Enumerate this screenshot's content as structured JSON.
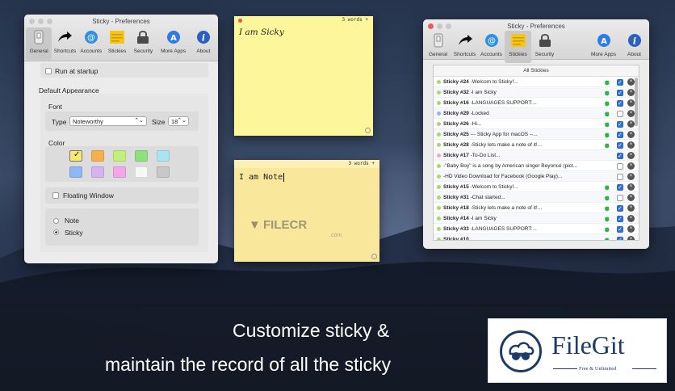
{
  "colors": {
    "sticky_yellow": "#fef69a",
    "note_yellow": "#f9e89b",
    "accent_blue": "#2f74d8",
    "evernote_green": "#2fb34a",
    "brand_navy": "#1e3a66"
  },
  "left_window": {
    "title": "Sticky - Preferences",
    "toolbar": [
      {
        "label": "General",
        "icon": "general-icon",
        "selected": true
      },
      {
        "label": "Shortcuts",
        "icon": "arrow-icon"
      },
      {
        "label": "Accounts",
        "icon": "at-icon"
      },
      {
        "label": "Stickies",
        "icon": "stickies-icon"
      },
      {
        "label": "Security",
        "icon": "lock-icon"
      },
      {
        "label": "More Apps",
        "icon": "app-store-icon"
      },
      {
        "label": "About",
        "icon": "info-icon"
      }
    ],
    "run_at_startup": "Run at startup",
    "default_appearance": "Default Appearance",
    "font_label": "Font",
    "type_label": "Type",
    "type_value": "Noteworthy",
    "size_label": "Size",
    "size_value": "18",
    "color_label": "Color",
    "swatches": [
      "#fbe96e",
      "#f5b04d",
      "#c4ef7c",
      "#8fe07e",
      "#a9e4f3",
      "#8fb7f2",
      "#d6b3f0",
      "#f2a8e8",
      "#f7f7f7",
      "#c8c8c8"
    ],
    "floating_window": "Floating Window",
    "radio_note": "Note",
    "radio_sticky": "Sticky"
  },
  "sticky_note": {
    "word_count": "3 words",
    "plus": "+",
    "text": "I am Sicky"
  },
  "note_note": {
    "word_count": "3 words",
    "plus": "+",
    "text": "I am Note"
  },
  "watermark": {
    "brand": "FILECR",
    "domain": ".com"
  },
  "right_window": {
    "title": "Sticky - Preferences",
    "toolbar": [
      {
        "label": "General",
        "icon": "general-icon"
      },
      {
        "label": "Shortcuts",
        "icon": "arrow-icon"
      },
      {
        "label": "Accounts",
        "icon": "at-icon"
      },
      {
        "label": "Stickies",
        "icon": "stickies-icon",
        "selected": true
      },
      {
        "label": "Security",
        "icon": "lock-icon"
      },
      {
        "label": "More Apps",
        "icon": "app-store-icon"
      },
      {
        "label": "About",
        "icon": "info-icon"
      }
    ],
    "list_header": "All Stickies",
    "rows": [
      {
        "text": "Sticky #24 -Welcom to Sticky!...",
        "dot": "#a8d96b",
        "evernote": true,
        "checked": true
      },
      {
        "text": "Sticky #32 -I am Sicky",
        "dot": "#a8d96b",
        "evernote": true,
        "checked": true
      },
      {
        "text": "Sticky #16 -LANGUAGES SUPPORT:...",
        "dot": "#a8d96b",
        "evernote": true,
        "checked": true
      },
      {
        "text": "Sticky #29 -Locked",
        "dot": "#8fb7f2",
        "evernote": true,
        "checked": false
      },
      {
        "text": "Sticky #26 -Hi...",
        "dot": "#a8d96b",
        "evernote": true,
        "checked": true
      },
      {
        "text": "Sticky #25 --- Sticky App for macOS --...",
        "dot": "#a8d96b",
        "evernote": true,
        "checked": true
      },
      {
        "text": "Sticky #28 -Sticky lets make a note of it!...",
        "dot": "#a8d96b",
        "evernote": true,
        "checked": true
      },
      {
        "text": "Sticky #17 -To-Do List...",
        "dot": "#f2a8c8",
        "evernote": false,
        "checked": true
      },
      {
        "text": "-\"Baby Boy\" is a song by American singer Beyoncé (pict...",
        "dot": "#a8d96b",
        "evernote": false,
        "checked": false
      },
      {
        "text": "-HD Video Download for Facebook (Google Play)...",
        "dot": "#a8d96b",
        "evernote": false,
        "checked": false
      },
      {
        "text": "Sticky #15 -Welcom to Sticky!...",
        "dot": "#a8d96b",
        "evernote": true,
        "checked": true
      },
      {
        "text": "Sticky #31 -Chat started...",
        "dot": "#a8d96b",
        "evernote": true,
        "checked": false
      },
      {
        "text": "Sticky #18 -Sticky lets make a note of it!...",
        "dot": "#a8d96b",
        "evernote": true,
        "checked": true
      },
      {
        "text": "Sticky #14 -I am Sicky",
        "dot": "#a8d96b",
        "evernote": true,
        "checked": true
      },
      {
        "text": "Sticky #33 -LANGUAGES SUPPORT:...",
        "dot": "#a8d96b",
        "evernote": true,
        "checked": true
      },
      {
        "text": "Sticky #10 ...",
        "dot": "#a8d96b",
        "evernote": true,
        "checked": true
      }
    ]
  },
  "caption": {
    "line1": "Customize sticky &",
    "line2": "maintain the record of all the sticky"
  },
  "logo": {
    "brand": "FileGit",
    "tagline": "Free & Unlimited"
  }
}
